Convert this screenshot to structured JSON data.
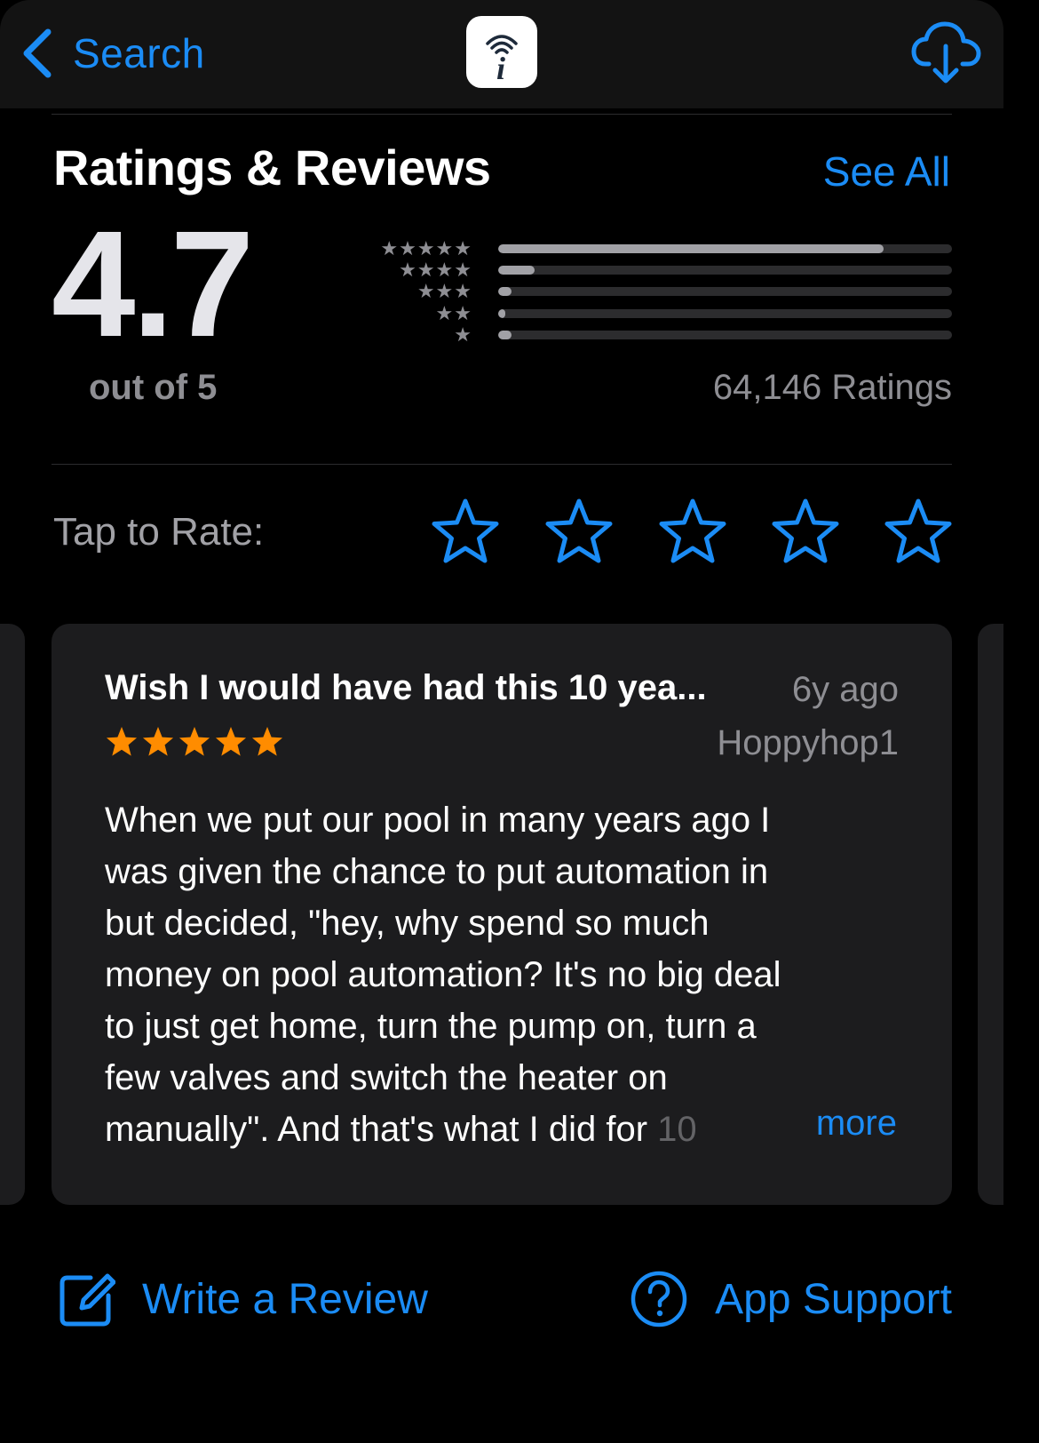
{
  "nav": {
    "back_label": "Search",
    "back_icon": "chevron-left-icon",
    "app_icon_letter": "i",
    "download_icon": "cloud-download-icon"
  },
  "ratings": {
    "title": "Ratings & Reviews",
    "see_all": "See All",
    "average": "4.7",
    "out_of": "out of 5",
    "count_label": "64,146 Ratings",
    "histogram": [
      {
        "stars": "★★★★★",
        "fraction": 0.85
      },
      {
        "stars": "★★★★",
        "fraction": 0.08
      },
      {
        "stars": "★★★",
        "fraction": 0.03
      },
      {
        "stars": "★★",
        "fraction": 0.01
      },
      {
        "stars": "★",
        "fraction": 0.03
      }
    ]
  },
  "tap_to_rate": {
    "label": "Tap to Rate:",
    "star_icon": "star-outline-icon",
    "count": 5
  },
  "review": {
    "title": "Wish I would have had this 10 yea...",
    "age": "6y ago",
    "author": "Hoppyhop1",
    "rating": 5,
    "lines": [
      "When we put our pool in many years ago I",
      "was given the chance to put automation in",
      "but decided, \"hey, why spend so much",
      "money on pool automation?  It's no big deal",
      "to just get home, turn the pump on, turn a",
      "few valves and switch the heater on"
    ],
    "last_line": "manually\".  And that's what I did for ",
    "last_line_faded": "10",
    "more": "more"
  },
  "actions": {
    "write_review": "Write a Review",
    "app_support": "App Support"
  },
  "colors": {
    "accent": "#1b8cf5",
    "star_orange": "#ff8c00",
    "background": "#000000",
    "card": "#1c1c1e",
    "secondary_text": "#8e8e93"
  }
}
